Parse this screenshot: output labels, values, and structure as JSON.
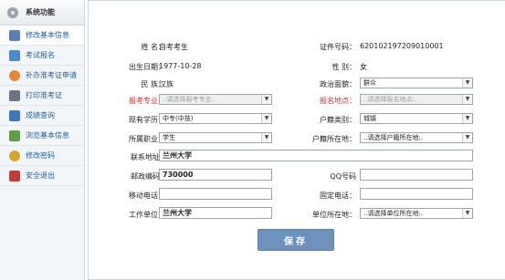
{
  "sidebar": {
    "title": "系统功能",
    "items": [
      {
        "label": "修改基本信息",
        "color": "#5b7fb0"
      },
      {
        "label": "考试报名",
        "color": "#4a8ccf"
      },
      {
        "label": "补办准考证申请",
        "color": "#e08a3a"
      },
      {
        "label": "打印准考证",
        "color": "#6d7680"
      },
      {
        "label": "成绩查询",
        "color": "#3d78b8"
      },
      {
        "label": "浏览基本信息",
        "color": "#5e9f46"
      },
      {
        "label": "修改密码",
        "color": "#d5a42a"
      },
      {
        "label": "安全退出",
        "color": "#c23c3c"
      }
    ]
  },
  "form": {
    "name_label": "姓 名：",
    "name_value": "自考考生",
    "id_label": "证件号码：",
    "id_value": "620102197209010001",
    "birth_label": "出生日期：",
    "birth_value": "1977-10-28",
    "gender_label": "性 别：",
    "gender_value": "女",
    "ethnic_label": "民 族：",
    "ethnic_value": "汉族",
    "political_label": "政治面貌：",
    "political_value": "群众",
    "major_label": "报考专业：",
    "major_placeholder": "..请选择报考专业:.",
    "site_label": "报名地点：",
    "site_placeholder": "..请选择报名地点:.",
    "education_label": "现有学历：",
    "education_value": "中专(中技)",
    "household_type_label": "户籍类别：",
    "household_type_value": "城镇",
    "occupation_label": "所属职业：",
    "occupation_value": "学生",
    "household_loc_label": "户籍所在地：",
    "household_loc_placeholder": "..请选择户籍所在地:.",
    "address_label": "联系地址",
    "address_value": "兰州大学",
    "postcode_label": "邮政编码",
    "postcode_value": "730000",
    "qq_label": "QQ号码",
    "qq_value": "",
    "mobile_label": "移动电话：",
    "mobile_value": "",
    "landline_label": "固定电话：",
    "landline_value": "",
    "employer_label": "工作单位：",
    "employer_value": "兰州大学",
    "employer_loc_label": "单位所在地：",
    "employer_loc_placeholder": "..请选择单位所在地:.",
    "save_label": "保存"
  }
}
